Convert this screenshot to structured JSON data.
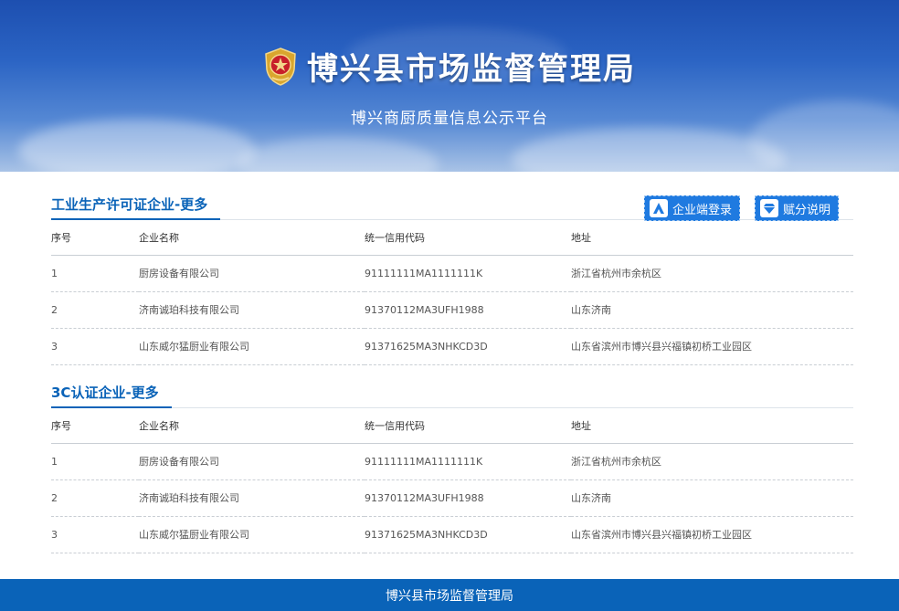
{
  "header": {
    "title": "博兴县市场监督管理局",
    "subtitle": "博兴商厨质量信息公示平台"
  },
  "buttons": {
    "login": "企业端登录",
    "score": "赋分说明"
  },
  "columns": [
    "序号",
    "企业名称",
    "统一信用代码",
    "地址"
  ],
  "sections": [
    {
      "title": "工业生产许可证企业-更多",
      "rows": [
        {
          "no": "1",
          "name": "厨房设备有限公司",
          "code": "91111111MA1111111K",
          "address": "浙江省杭州市余杭区"
        },
        {
          "no": "2",
          "name": "济南诚珀科技有限公司",
          "code": "91370112MA3UFH1988",
          "address": "山东济南"
        },
        {
          "no": "3",
          "name": "山东威尔猛厨业有限公司",
          "code": "91371625MA3NHKCD3D",
          "address": "山东省滨州市博兴县兴福镇初桥工业园区"
        }
      ]
    },
    {
      "title": "3C认证企业-更多",
      "rows": [
        {
          "no": "1",
          "name": "厨房设备有限公司",
          "code": "91111111MA1111111K",
          "address": "浙江省杭州市余杭区"
        },
        {
          "no": "2",
          "name": "济南诚珀科技有限公司",
          "code": "91370112MA3UFH1988",
          "address": "山东济南"
        },
        {
          "no": "3",
          "name": "山东威尔猛厨业有限公司",
          "code": "91371625MA3NHKCD3D",
          "address": "山东省滨州市博兴县兴福镇初桥工业园区"
        }
      ]
    }
  ],
  "footer": {
    "text": "博兴县市场监督管理局"
  },
  "colors": {
    "primary": "#0a63b8",
    "button": "#1f7ae0",
    "emblem_gold": "#d9a62e",
    "emblem_red": "#c8202a"
  }
}
